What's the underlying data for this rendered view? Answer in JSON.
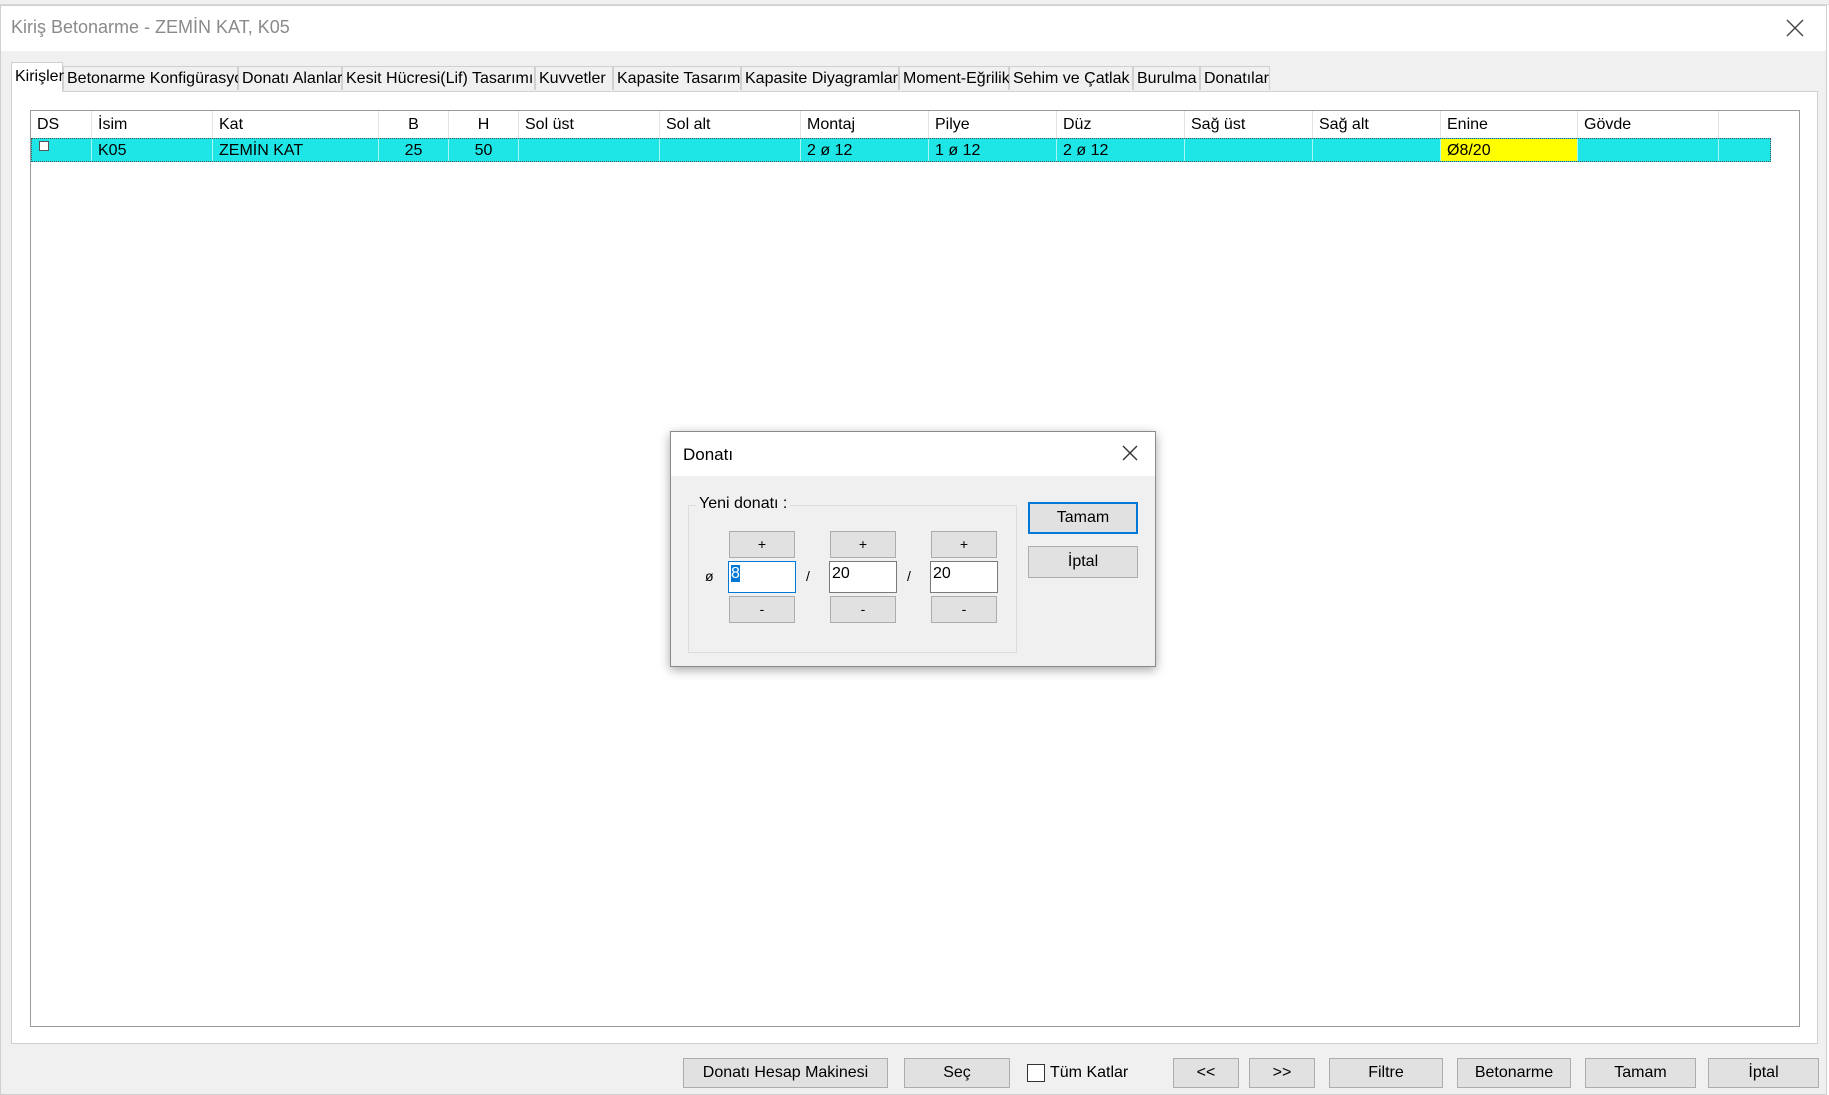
{
  "window": {
    "title": "Kiriş Betonarme - ZEMİN KAT, K05"
  },
  "tabs": [
    {
      "label": "Kirişler",
      "active": true
    },
    {
      "label": "Betonarme Konfigürasyonu"
    },
    {
      "label": "Donatı Alanları"
    },
    {
      "label": "Kesit Hücresi(Lif) Tasarımı"
    },
    {
      "label": "Kuvvetler"
    },
    {
      "label": "Kapasite Tasarımı"
    },
    {
      "label": "Kapasite Diyagramları"
    },
    {
      "label": "Moment-Eğrilik"
    },
    {
      "label": "Sehim ve Çatlak"
    },
    {
      "label": "Burulma"
    },
    {
      "label": "Donatılar"
    }
  ],
  "grid": {
    "columns": [
      "DS",
      "İsim",
      "Kat",
      "B",
      "H",
      "Sol üst",
      "Sol alt",
      "Montaj",
      "Pilye",
      "Düz",
      "Sağ üst",
      "Sağ alt",
      "Enine",
      "Gövde"
    ],
    "rows": [
      {
        "ds": "",
        "isim": "K05",
        "kat": "ZEMİN KAT",
        "b": "25",
        "h": "50",
        "sol_ust": "",
        "sol_alt": "",
        "montaj": "2 ø 12",
        "pilye": "1 ø 12",
        "duz": "2 ø 12",
        "sag_ust": "",
        "sag_alt": "",
        "enine": "Ø8/20",
        "govde": ""
      }
    ],
    "selected_row_color": "#1fe6e6",
    "highlight_cell_color": "#ffff00"
  },
  "dialog": {
    "title": "Donatı",
    "group_label": "Yeni donatı :",
    "plus": "+",
    "minus": "-",
    "phi": "ø",
    "slash": "/",
    "diameter": "8",
    "spacing1": "20",
    "spacing2": "20",
    "ok": "Tamam",
    "cancel": "İptal"
  },
  "bottom_bar": {
    "calculator": "Donatı Hesap Makinesi",
    "select": "Seç",
    "all_floors": "Tüm Katlar",
    "all_floors_checked": false,
    "prev": "<<",
    "next": ">>",
    "filter": "Filtre",
    "reinforced": "Betonarme",
    "ok": "Tamam",
    "cancel": "İptal"
  }
}
